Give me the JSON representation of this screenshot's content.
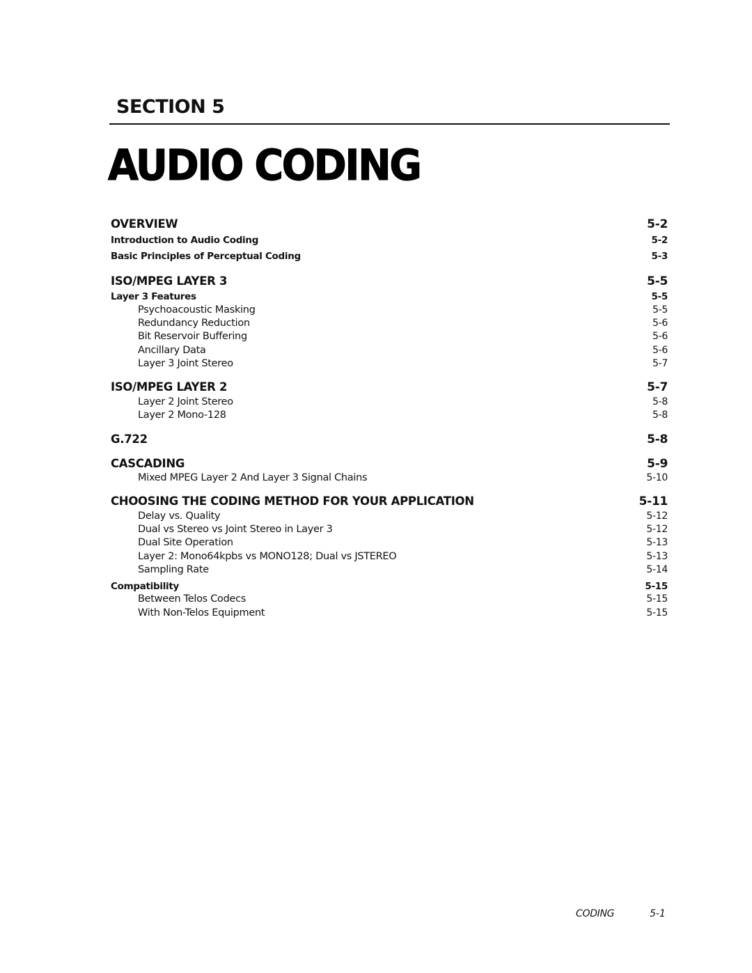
{
  "header": {
    "section_label": "SECTION 5",
    "title": "AUDIO CODING"
  },
  "toc": [
    {
      "level": 1,
      "text": "OVERVIEW",
      "page": "5-2"
    },
    {
      "level": 2,
      "text": "Introduction to Audio Coding",
      "page": "5-2"
    },
    {
      "level": 2,
      "text": "Basic Principles of Perceptual Coding",
      "page": "5-3"
    },
    {
      "level": 1,
      "text": "ISO/MPEG LAYER 3",
      "page": "5-5"
    },
    {
      "level": 2,
      "text": "Layer 3 Features",
      "page": "5-5"
    },
    {
      "level": 3,
      "text": "Psychoacoustic Masking",
      "page": "5-5"
    },
    {
      "level": 3,
      "text": "Redundancy Reduction",
      "page": "5-6"
    },
    {
      "level": 3,
      "text": "Bit Reservoir Buffering",
      "page": "5-6"
    },
    {
      "level": 3,
      "text": "Ancillary Data",
      "page": "5-6"
    },
    {
      "level": 3,
      "text": "Layer 3 Joint Stereo",
      "page": "5-7"
    },
    {
      "level": 1,
      "text": "ISO/MPEG LAYER 2",
      "page": "5-7"
    },
    {
      "level": 3,
      "text": "Layer 2 Joint Stereo",
      "page": "5-8"
    },
    {
      "level": 3,
      "text": "Layer 2 Mono-128",
      "page": "5-8"
    },
    {
      "level": 1,
      "text": "G.722",
      "page": "5-8"
    },
    {
      "level": 1,
      "text": "CASCADING",
      "page": "5-9"
    },
    {
      "level": 3,
      "text": "Mixed MPEG Layer 2 And Layer 3 Signal Chains",
      "page": "5-10"
    },
    {
      "level": 1,
      "text": "CHOOSING THE CODING METHOD FOR YOUR APPLICATION",
      "page": "5-11"
    },
    {
      "level": 3,
      "text": "Delay vs. Quality",
      "page": "5-12"
    },
    {
      "level": 3,
      "text": "Dual vs Stereo vs Joint Stereo in Layer 3",
      "page": "5-12"
    },
    {
      "level": 3,
      "text": "Dual Site Operation",
      "page": "5-13"
    },
    {
      "level": 3,
      "text": "Layer 2: Mono64kpbs vs MONO128; Dual vs JSTEREO",
      "page": "5-13"
    },
    {
      "level": 3,
      "text": "Sampling Rate",
      "page": "5-14"
    },
    {
      "level": 2,
      "text": "Compatibility",
      "page": "5-15"
    },
    {
      "level": 3,
      "text": "Between Telos Codecs",
      "page": "5-15"
    },
    {
      "level": 3,
      "text": "With Non-Telos Equipment",
      "page": "5-15"
    }
  ],
  "footer": {
    "running_title": "CODING",
    "page_number": "5-1"
  }
}
